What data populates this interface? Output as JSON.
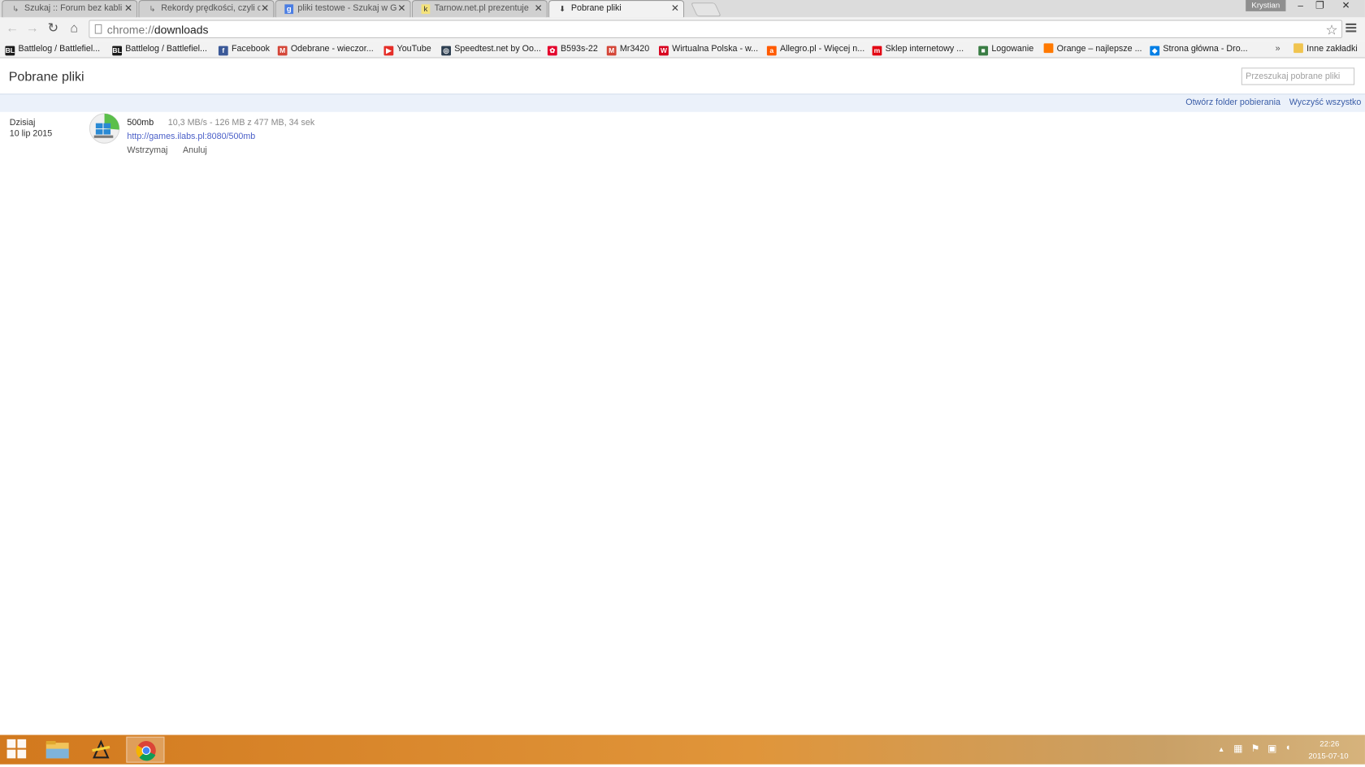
{
  "tabs": [
    {
      "title": "Szukaj :: Forum bez kabli",
      "icon": "forum-icon",
      "active": false
    },
    {
      "title": "Rekordy prędkości, czyli c",
      "icon": "forum-icon",
      "active": false
    },
    {
      "title": "pliki testowe - Szukaj w G",
      "icon": "google-icon",
      "active": false
    },
    {
      "title": "Tarnow.net.pl prezentuje",
      "icon": "tarnow-icon",
      "active": false
    },
    {
      "title": "Pobrane pliki",
      "icon": "download-icon",
      "active": true
    }
  ],
  "window": {
    "profile_name": "Krystian",
    "minimize": "‒",
    "restore": "❐",
    "close": "✕"
  },
  "toolbar": {
    "url_scheme": "chrome://",
    "url_path": "downloads"
  },
  "bookmarks": [
    {
      "label": "Battlelog / Battlefiel...",
      "icon": "battlelog-icon",
      "color": "#1a1a1a"
    },
    {
      "label": "Battlelog / Battlefiel...",
      "icon": "battlelog-icon",
      "color": "#1a1a1a"
    },
    {
      "label": "Facebook",
      "icon": "facebook-icon",
      "color": "#3b5998"
    },
    {
      "label": "Odebrane - wieczor...",
      "icon": "gmail-icon",
      "color": "#d44638"
    },
    {
      "label": "YouTube",
      "icon": "youtube-icon",
      "color": "#e52d27"
    },
    {
      "label": "Speedtest.net by Oo...",
      "icon": "speedtest-icon",
      "color": "#2d3e50"
    },
    {
      "label": "B593s-22",
      "icon": "huawei-icon",
      "color": "#e4002b"
    },
    {
      "label": "Mr3420",
      "icon": "gmail-icon",
      "color": "#d44638"
    },
    {
      "label": "Wirtualna Polska - w...",
      "icon": "wp-icon",
      "color": "#d8001e"
    },
    {
      "label": "Allegro.pl - Więcej n...",
      "icon": "allegro-icon",
      "color": "#ff5a00"
    },
    {
      "label": "Sklep internetowy ...",
      "icon": "sklep-icon",
      "color": "#e30613"
    },
    {
      "label": "Logowanie",
      "icon": "login-icon",
      "color": "#3a7d44"
    },
    {
      "label": "Orange – najlepsze ...",
      "icon": "orange-icon",
      "color": "#ff7900"
    },
    {
      "label": "Strona główna - Dro...",
      "icon": "dropbox-icon",
      "color": "#007ee5"
    }
  ],
  "bookmarks_overflow": "»",
  "other_bookmarks": "Inne zakładki",
  "page": {
    "title": "Pobrane pliki",
    "search_placeholder": "Przeszukaj pobrane pliki",
    "open_folder": "Otwórz folder pobierania",
    "clear_all": "Wyczyść wszystko"
  },
  "download": {
    "date_label": "Dzisiaj",
    "date": "10 lip 2015",
    "file_name": "500mb",
    "status": "10,3 MB/s - 126 MB z 477 MB, 34 sek",
    "url": "http://games.ilabs.pl:8080/500mb",
    "progress": 0.264,
    "pause_label": "Wstrzymaj",
    "cancel_label": "Anuluj"
  },
  "taskbar": {
    "apps": [
      "file-explorer-icon",
      "winamp-icon",
      "chrome-icon"
    ],
    "time": "22:26",
    "date": "2015-07-10"
  }
}
